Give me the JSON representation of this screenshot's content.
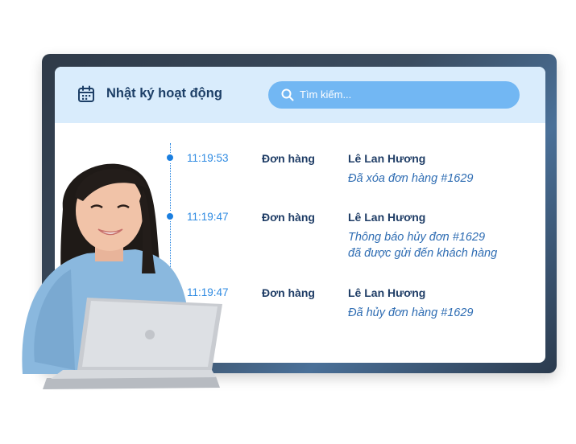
{
  "header": {
    "title": "Nhật ký hoạt động",
    "search_placeholder": "Tìm kiếm..."
  },
  "entries": [
    {
      "time": "11:19:53",
      "category": "Đơn hàng",
      "user": "Lê Lan Hương",
      "desc_line1": "Đã xóa đơn hàng #1629",
      "desc_line2": ""
    },
    {
      "time": "11:19:47",
      "category": "Đơn hàng",
      "user": "Lê Lan Hương",
      "desc_line1": "Thông báo hủy đơn #1629",
      "desc_line2": "đã được gửi đến khách hàng"
    },
    {
      "time": "11:19:47",
      "category": "Đơn hàng",
      "user": "Lê Lan Hương",
      "desc_line1": "Đã hủy đơn hàng #1629",
      "desc_line2": ""
    }
  ],
  "colors": {
    "header_bg": "#d9ecfc",
    "search_bg": "#72b7f3",
    "accent": "#1b7fe0",
    "title": "#1d3f67"
  },
  "icons": [
    "calendar-icon",
    "search-icon"
  ]
}
